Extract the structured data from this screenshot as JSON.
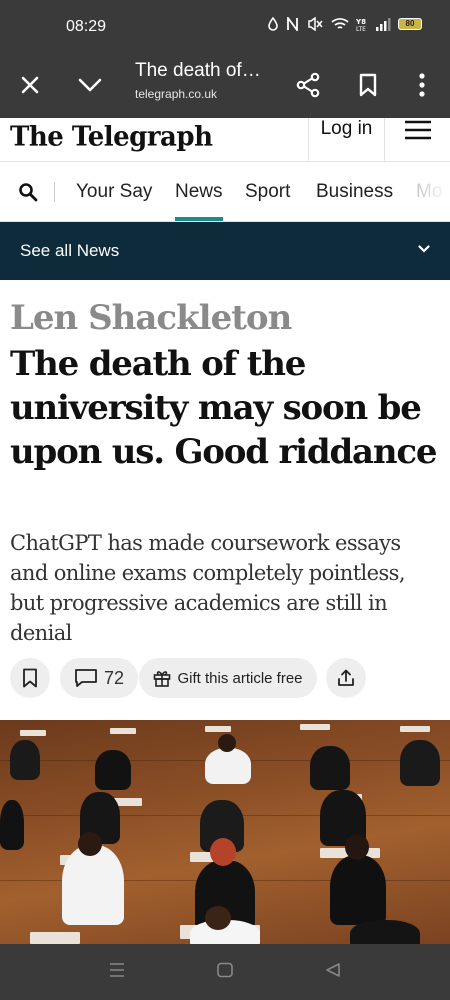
{
  "status_bar": {
    "time": "08:29",
    "battery_level": "80",
    "icons": [
      "data-saver-icon",
      "nfc-icon",
      "mute-icon",
      "wifi-icon",
      "volte-icon",
      "signal-icon",
      "battery-icon"
    ]
  },
  "browser": {
    "page_title": "The death of…",
    "url": "telegraph.co.uk",
    "icons": [
      "close-icon",
      "chevron-down-icon",
      "share-icon",
      "bookmark-icon",
      "more-vert-icon"
    ]
  },
  "site_header": {
    "logo_text": "The Telegraph",
    "login_label": "Log in",
    "menu_icon": "hamburger-icon"
  },
  "nav": {
    "items": [
      {
        "label": "Your Say"
      },
      {
        "label": "News",
        "active": true
      },
      {
        "label": "Sport"
      },
      {
        "label": "Business"
      },
      {
        "label": "Mo"
      }
    ]
  },
  "section_bar": {
    "label": "See all News"
  },
  "article": {
    "author": "Len Shackleton",
    "headline": "The death of the university may soon be upon us. Good riddance",
    "standfirst": "ChatGPT has made coursework essays and online exams completely pointless, but progressive academics are still in denial",
    "comment_count": "72",
    "gift_label": "Gift this article free"
  },
  "colors": {
    "chrome": "#3a3a3a",
    "section_bar": "#0d2b3a",
    "nav_active": "#1c8a87",
    "author": "#8a8a8a"
  }
}
